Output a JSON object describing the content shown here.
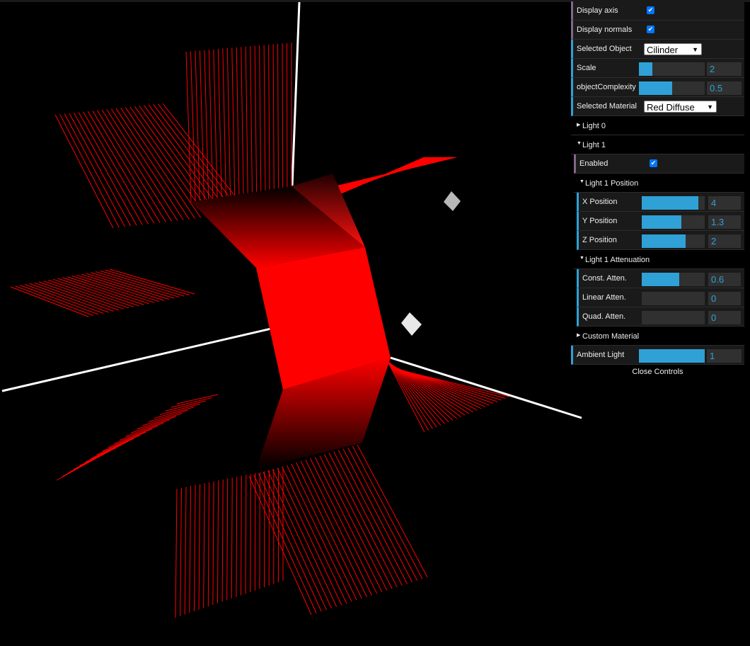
{
  "gui": {
    "display_axis": {
      "label": "Display axis",
      "checked": true
    },
    "display_normals": {
      "label": "Display normals",
      "checked": true
    },
    "selected_object": {
      "label": "Selected Object",
      "value": "Cilinder"
    },
    "scale": {
      "label": "Scale",
      "value": "2",
      "fill": 0.2
    },
    "object_complexity": {
      "label": "objectComplexity",
      "value": "0.5",
      "fill": 0.5
    },
    "selected_material": {
      "label": "Selected Material",
      "value": "Red Diffuse"
    },
    "light0": {
      "label": "Light 0"
    },
    "light1": {
      "label": "Light 1",
      "enabled": {
        "label": "Enabled",
        "checked": true
      },
      "position_folder": "Light 1 Position",
      "x": {
        "label": "X Position",
        "value": "4",
        "fill": 0.9
      },
      "y": {
        "label": "Y Position",
        "value": "1.3",
        "fill": 0.63
      },
      "z": {
        "label": "Z Position",
        "value": "2",
        "fill": 0.7
      },
      "attenuation_folder": "Light 1 Attenuation",
      "const": {
        "label": "Const. Atten.",
        "value": "0.6",
        "fill": 0.6
      },
      "linear": {
        "label": "Linear Atten.",
        "value": "0",
        "fill": 0
      },
      "quad": {
        "label": "Quad. Atten.",
        "value": "0",
        "fill": 0
      }
    },
    "custom_material": {
      "label": "Custom Material"
    },
    "ambient_light": {
      "label": "Ambient Light",
      "value": "1",
      "fill": 1.0
    },
    "close_controls": "Close Controls"
  },
  "colors": {
    "accent": "#2fa1d6",
    "boolean": "#806787",
    "object": "#ff0000",
    "normals": "#ff0000"
  },
  "icons": {
    "checkbox": "checkmark-icon",
    "folder_open": "triangle-down-icon",
    "folder_closed": "triangle-right-icon"
  }
}
